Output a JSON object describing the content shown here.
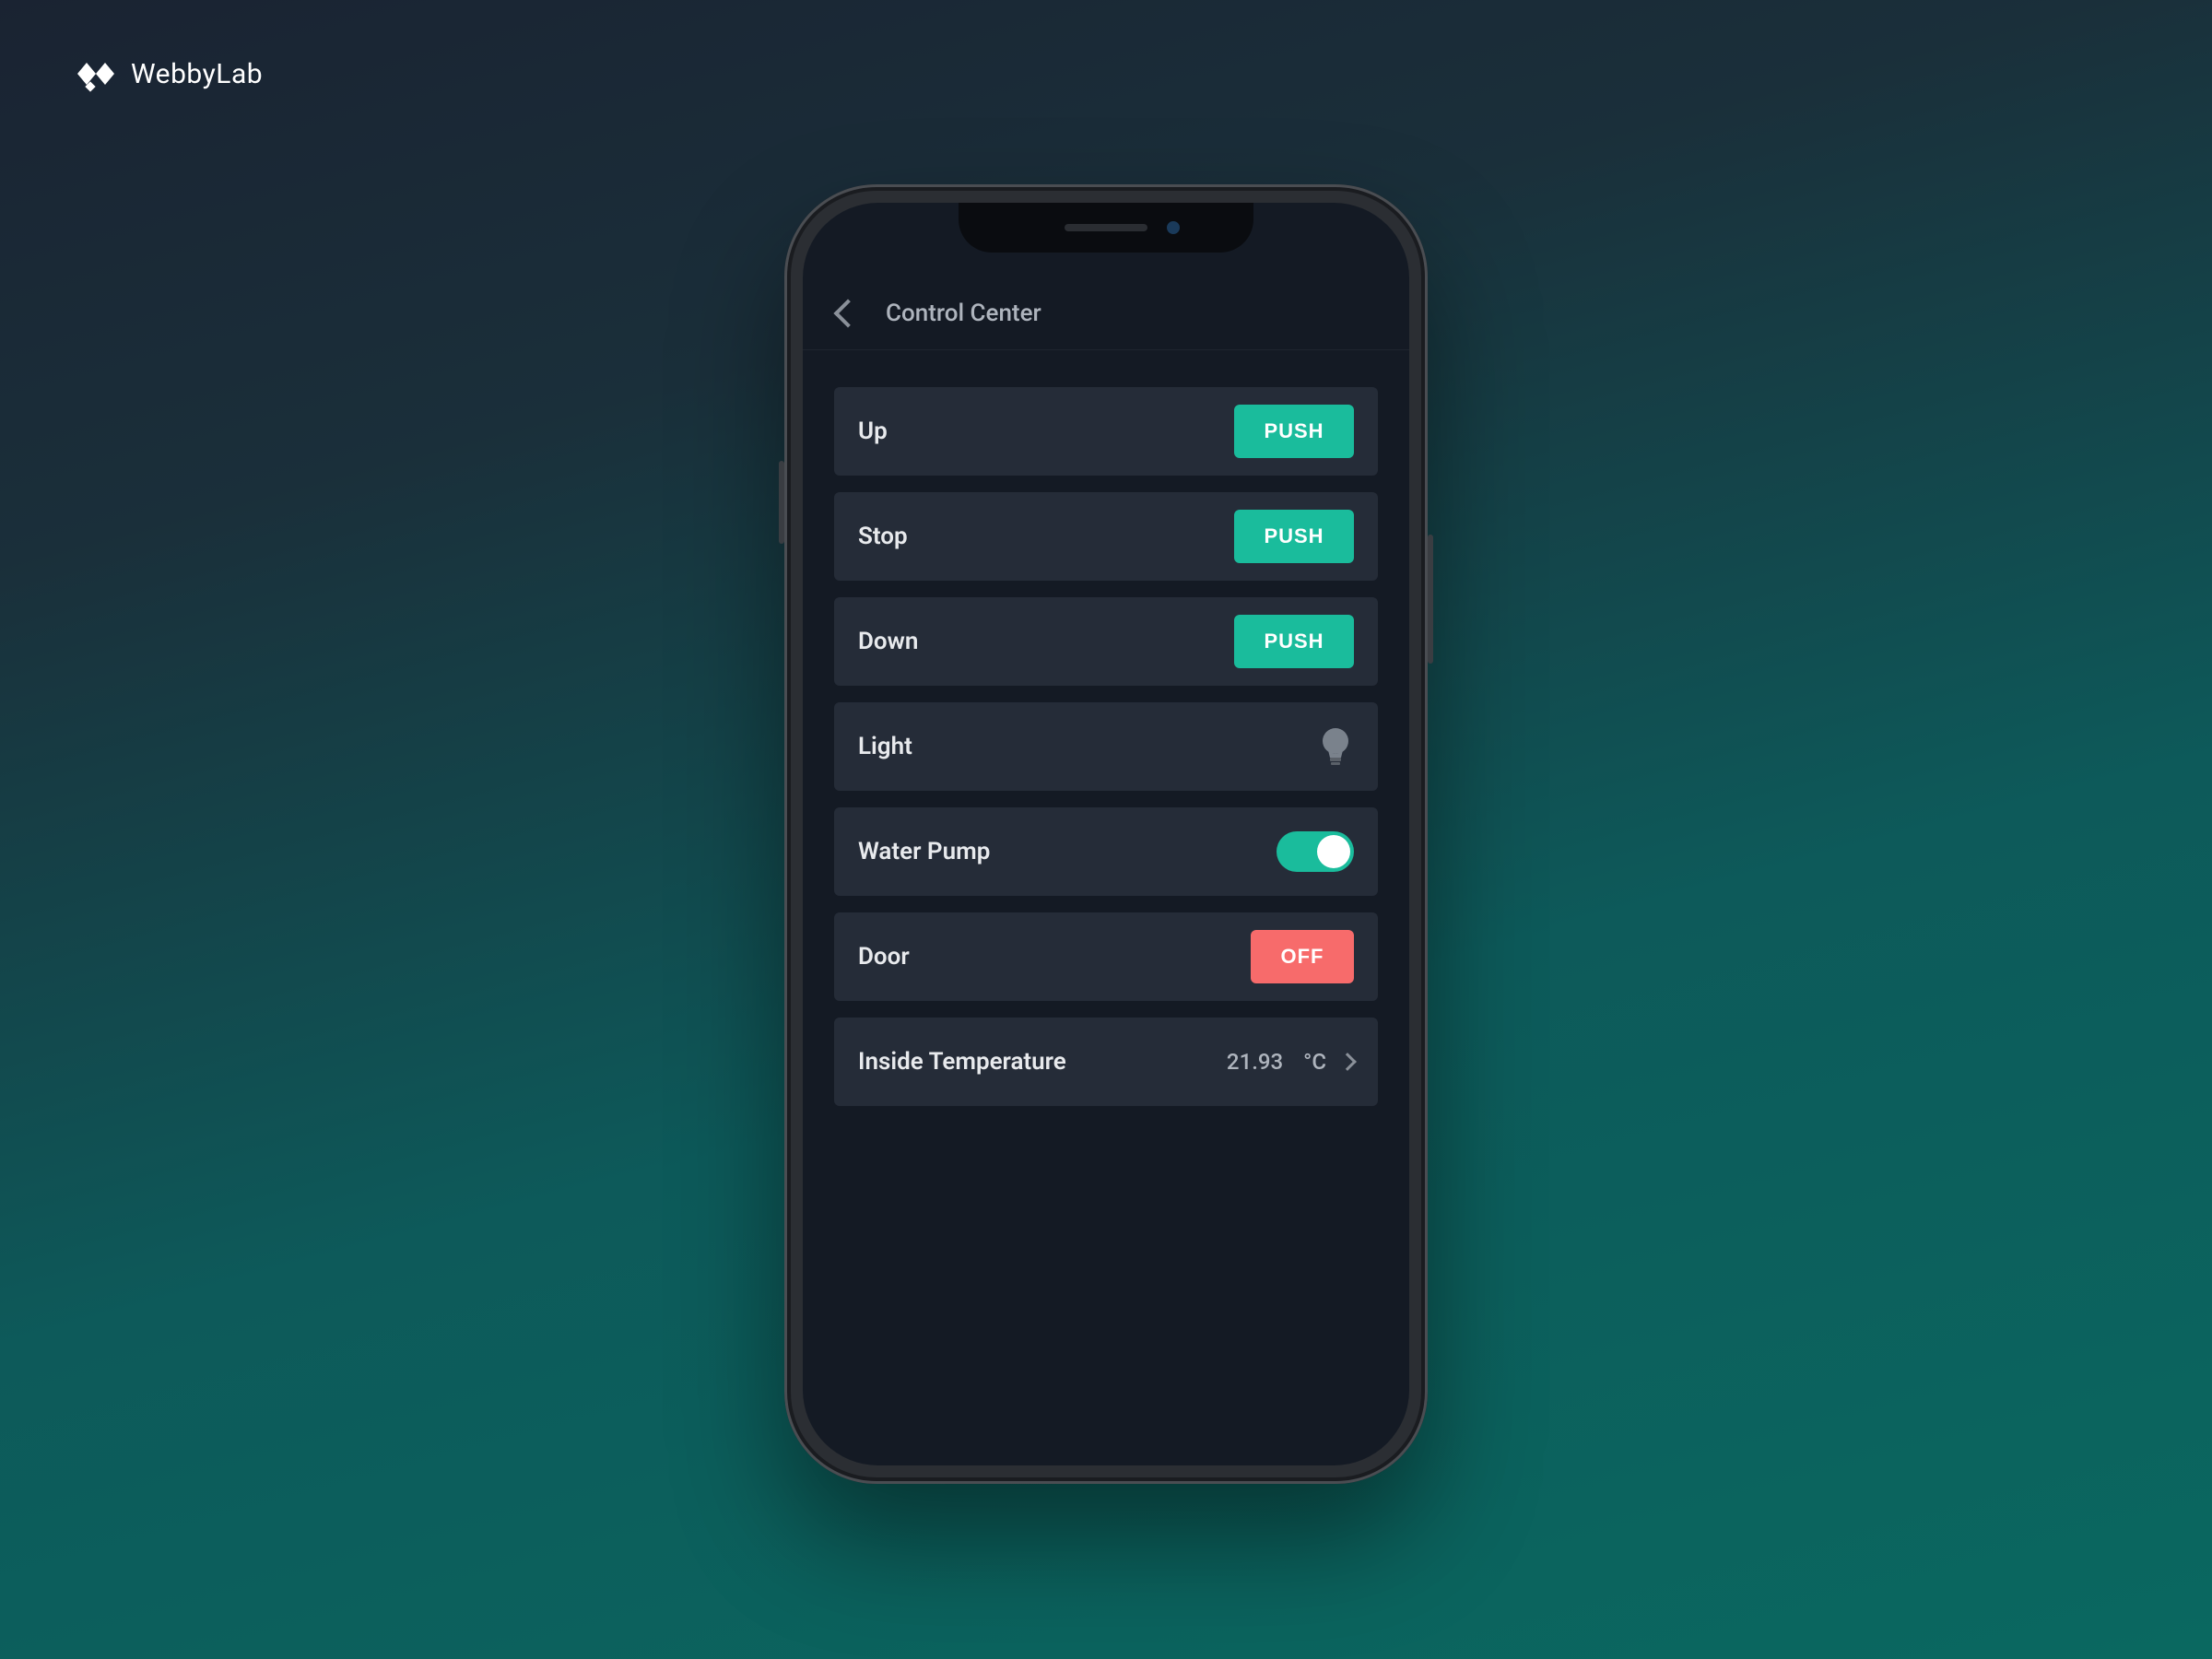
{
  "brand": {
    "name": "WebbyLab"
  },
  "header": {
    "title": "Control Center"
  },
  "controls": {
    "up": {
      "label": "Up",
      "button": "PUSH"
    },
    "stop": {
      "label": "Stop",
      "button": "PUSH"
    },
    "down": {
      "label": "Down",
      "button": "PUSH"
    },
    "light": {
      "label": "Light"
    },
    "pump": {
      "label": "Water Pump",
      "state": "on"
    },
    "door": {
      "label": "Door",
      "button": "OFF"
    },
    "temp": {
      "label": "Inside Temperature",
      "value": "21.93",
      "unit": "°C"
    }
  },
  "colors": {
    "accent": "#1abc9c",
    "danger": "#f76b6b",
    "card": "#252c38",
    "screen": "#141a24"
  }
}
